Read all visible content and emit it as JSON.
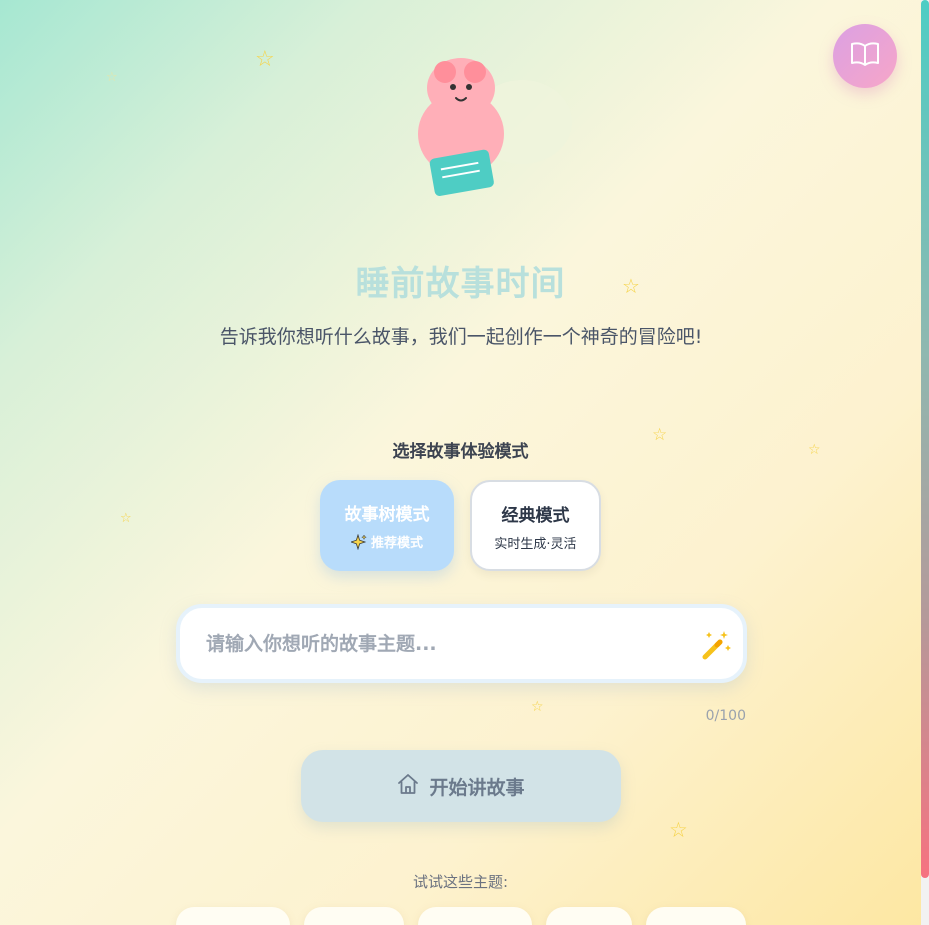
{
  "header": {
    "book_button_icon": "open-book-icon"
  },
  "hero": {
    "title": "睡前故事时间",
    "subtitle": "告诉我你想听什么故事，我们一起创作一个神奇的冒险吧!"
  },
  "modes": {
    "heading": "选择故事体验模式",
    "tree": {
      "title": "故事树模式",
      "subtitle": "推荐模式",
      "icon": "sparkles-icon",
      "selected": true
    },
    "classic": {
      "title": "经典模式",
      "subtitle": "实时生成·灵活",
      "selected": false
    }
  },
  "input": {
    "placeholder": "请输入你想听的故事主题...",
    "value": "",
    "char_count": "0/100",
    "wand_icon": "magic-wand-icon"
  },
  "start": {
    "label": "开始讲故事",
    "icon": "home-icon"
  },
  "suggestions": {
    "label": "试试这些主题:",
    "chips": [
      "",
      "",
      "",
      "",
      ""
    ]
  },
  "colors": {
    "accent_teal": "#4ecdc4",
    "title_color": "#b8e0dc",
    "mode_selected": "#b8dcfb",
    "star_yellow": "#f6d44b",
    "book_button_pink": "#f7a6c8"
  }
}
